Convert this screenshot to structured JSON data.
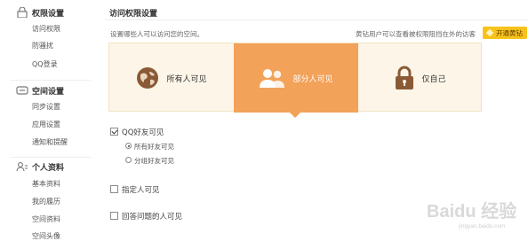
{
  "sidebar": {
    "sections": [
      {
        "title": "权限设置",
        "icon": "lock-icon",
        "items": [
          "访问权限",
          "防骚扰",
          "QQ登录"
        ]
      },
      {
        "title": "空间设置",
        "icon": "space-icon",
        "items": [
          "同步设置",
          "应用设置",
          "通知和提醒"
        ]
      },
      {
        "title": "个人资料",
        "icon": "user-icon",
        "items": [
          "基本资料",
          "我的履历",
          "空间资料",
          "空间头像"
        ]
      }
    ]
  },
  "main": {
    "title": "访问权限设置",
    "description": "设置哪些人可以访问您的空间。",
    "diamond_note": "黄钻用户可以查看被权限阻挡在外的访客",
    "open_diamond_label": "开通黄钻"
  },
  "options": [
    {
      "label": "所有人可见",
      "icon": "globe-icon",
      "selected": false
    },
    {
      "label": "部分人可见",
      "icon": "people-icon",
      "selected": true
    },
    {
      "label": "仅自己",
      "icon": "padlock-icon",
      "selected": false
    }
  ],
  "settings": {
    "qq_friends": {
      "label": "QQ好友可见",
      "checked": true
    },
    "radios": [
      {
        "label": "所有好友可见",
        "selected": true
      },
      {
        "label": "分组好友可见",
        "selected": false
      }
    ],
    "specified": {
      "label": "指定人可见",
      "checked": false
    },
    "answer": {
      "label": "回答问题的人可见",
      "checked": false
    }
  },
  "watermark": {
    "text": "Baidu 经验",
    "sub": "jingyan.baidu.com"
  },
  "colors": {
    "accent": "#f3a259",
    "panel_bg": "#fdf6e8",
    "diamond": "#f7c31b"
  }
}
